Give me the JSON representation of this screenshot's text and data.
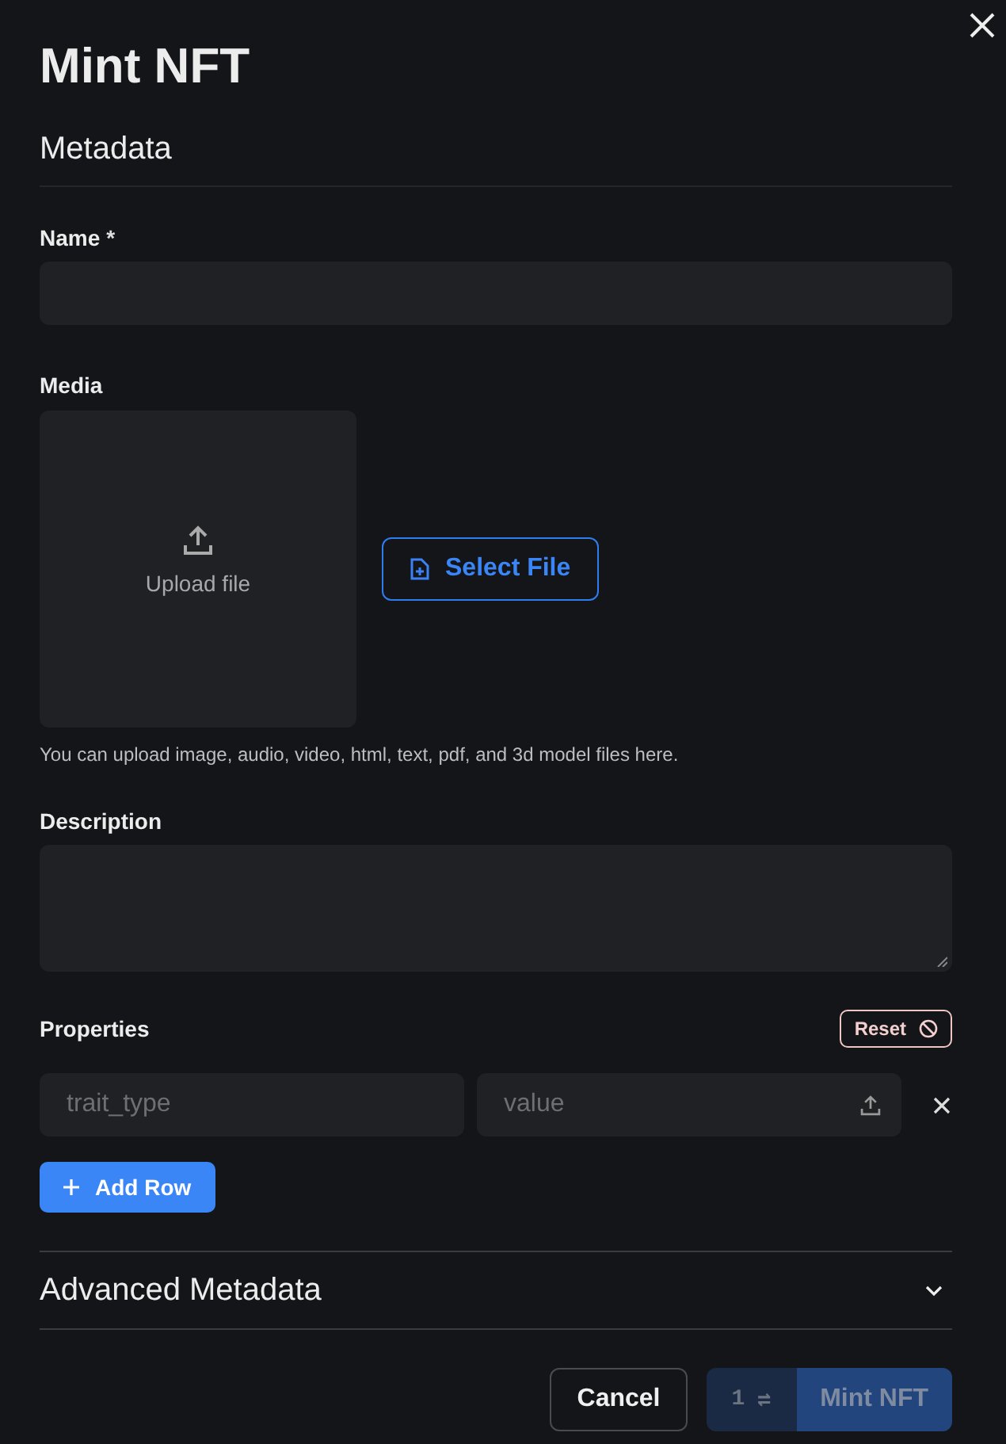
{
  "dialog": {
    "title": "Mint NFT",
    "section_title": "Metadata"
  },
  "name_field": {
    "label": "Name",
    "required_mark": "*"
  },
  "media": {
    "label": "Media",
    "dropzone_text": "Upload file",
    "select_button": "Select File",
    "hint": "You can upload image, audio, video, html, text, pdf, and 3d model files here."
  },
  "description": {
    "label": "Description"
  },
  "properties": {
    "label": "Properties",
    "reset_button": "Reset",
    "rows": [
      {
        "trait_placeholder": "trait_type",
        "value_placeholder": "value"
      }
    ],
    "add_button": "Add Row"
  },
  "advanced": {
    "title": "Advanced Metadata",
    "expanded": false
  },
  "footer": {
    "cancel_button": "Cancel",
    "count": "1",
    "swap_symbol": "⇌",
    "mint_button": "Mint NFT",
    "disabled": true
  }
}
